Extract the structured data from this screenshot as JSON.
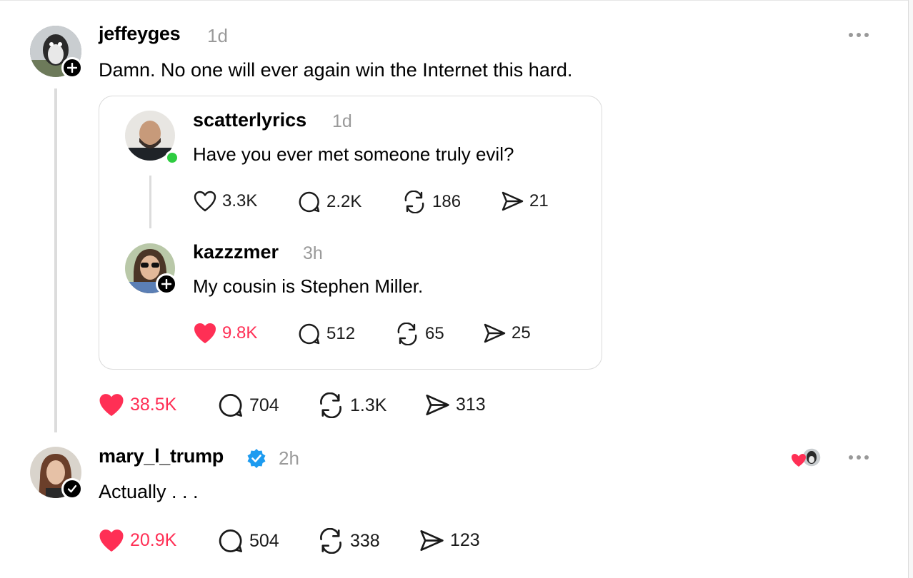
{
  "post1": {
    "username": "jeffeyges",
    "time": "1d",
    "text": "Damn. No one will ever again win the Internet this hard.",
    "actions": {
      "likes": "38.5K",
      "replies": "704",
      "reposts": "1.3K",
      "shares": "313"
    },
    "avatar_icon": "penguin-avatar",
    "badge_icon": "follow-plus-icon"
  },
  "quote": {
    "post": {
      "username": "scatterlyrics",
      "time": "1d",
      "text": "Have you ever met someone truly evil?",
      "actions": {
        "likes": "3.3K",
        "replies": "2.2K",
        "reposts": "186",
        "shares": "21"
      },
      "status": "online"
    },
    "reply": {
      "username": "kazzzmer",
      "time": "3h",
      "text": "My cousin is Stephen Miller.",
      "actions": {
        "likes": "9.8K",
        "replies": "512",
        "reposts": "65",
        "shares": "25"
      },
      "badge_icon": "follow-plus-icon"
    }
  },
  "post2": {
    "username": "mary_l_trump",
    "verified": true,
    "time": "2h",
    "text": "Actually . . .",
    "actions": {
      "likes": "20.9K",
      "replies": "504",
      "reposts": "338",
      "shares": "123"
    },
    "badge_icon": "following-check-icon",
    "liked_by_icon": "heart-liked-by-avatar"
  },
  "colors": {
    "like_red": "#ff2f55",
    "verified_blue": "#1d9bf0",
    "online_green": "#2ecc40",
    "muted": "#9a9a9a"
  }
}
